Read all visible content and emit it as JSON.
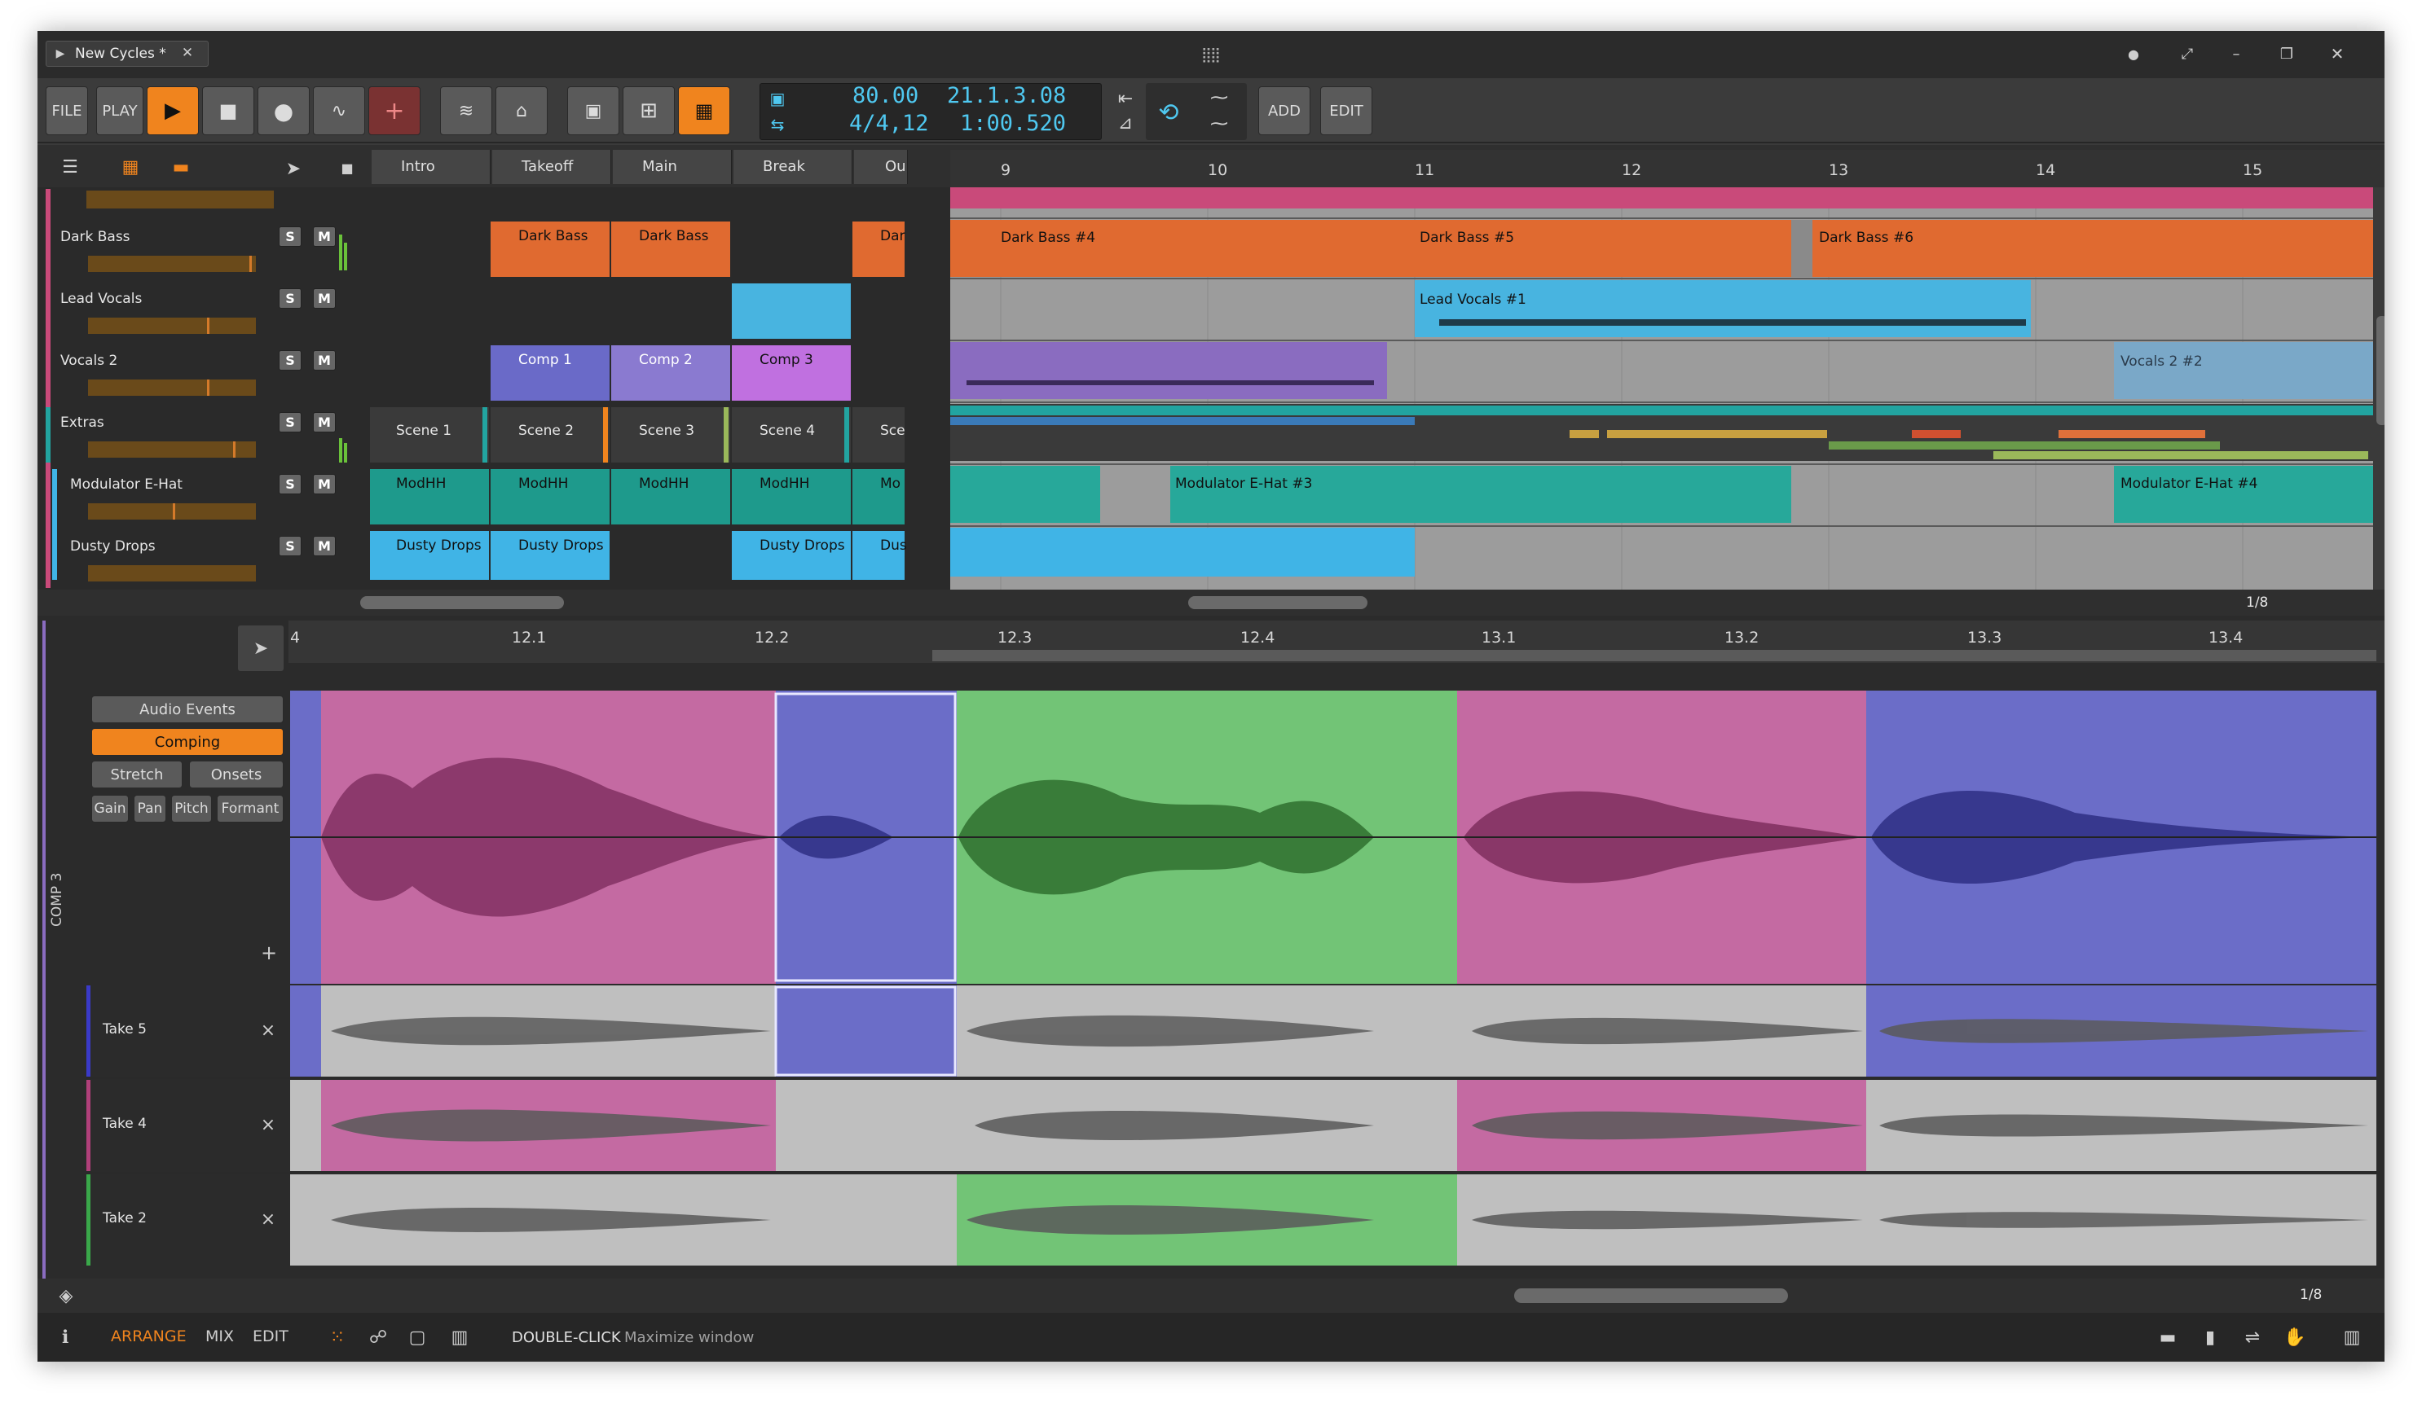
{
  "title_bar": {
    "tab_label": "New Cycles *",
    "close": "✕"
  },
  "transport": {
    "file_label": "FILE",
    "play_label": "PLAY",
    "tempo": "80.00",
    "time_signature": "4/4,12",
    "position_bars": "21.1.3.08",
    "position_time": "1:00.520",
    "add_label": "ADD",
    "edit_label": "EDIT"
  },
  "scenes": [
    "Intro",
    "Takeoff",
    "Main",
    "Break",
    "Ou"
  ],
  "timeline_bars": [
    "9",
    "10",
    "11",
    "12",
    "13",
    "14",
    "15"
  ],
  "tracks": [
    {
      "name": "Dark Bass",
      "clips": [
        "Dark Bass",
        "Dark Bass",
        "",
        "Dar"
      ],
      "arr": [
        "Dark Bass #4",
        "Dark Bass #5",
        "Dark Bass #6"
      ]
    },
    {
      "name": "Lead Vocals",
      "arr": [
        "Lead Vocals #1"
      ]
    },
    {
      "name": "Vocals 2",
      "clips": [
        "Comp 1",
        "Comp 2",
        "Comp 3"
      ],
      "arr": [
        "Vocals 2 #2"
      ]
    },
    {
      "name": "Extras",
      "clips": [
        "Scene 1",
        "Scene 2",
        "Scene 3",
        "Scene 4",
        "Sce"
      ]
    },
    {
      "name": "Modulator E-Hat",
      "clips": [
        "ModHH",
        "ModHH",
        "ModHH",
        "ModHH",
        "Mo"
      ],
      "arr": [
        "Modulator E-Hat #3",
        "Modulator E-Hat #4"
      ]
    },
    {
      "name": "Dusty Drops",
      "clips": [
        "Dusty Drops",
        "Dusty Drops",
        "Dusty Drops",
        "Dus"
      ]
    }
  ],
  "track_buttons": {
    "solo": "S",
    "mute": "M"
  },
  "zoom_top": "1/8",
  "zoom_bottom": "1/8",
  "editor": {
    "ruler": [
      "4",
      "12.1",
      "12.2",
      "12.3",
      "12.4",
      "13.1",
      "13.2",
      "13.3",
      "13.4"
    ],
    "buttons": {
      "audio_events": "Audio Events",
      "comping": "Comping",
      "stretch": "Stretch",
      "onsets": "Onsets",
      "gain": "Gain",
      "pan": "Pan",
      "pitch": "Pitch",
      "formant": "Formant"
    },
    "comp_label": "COMP 3",
    "plus": "+",
    "takes": [
      "Take 5",
      "Take 4",
      "Take 2"
    ],
    "take_close": "×"
  },
  "status_bar": {
    "arrange": "ARRANGE",
    "mix": "MIX",
    "edit": "EDIT",
    "hint_key": "DOUBLE-CLICK",
    "hint_text": "Maximize window"
  },
  "colors": {
    "accent": "#f0841e",
    "comp_pink": "#c46aa2",
    "comp_blue": "#6b6dc8",
    "comp_green": "#72c476",
    "lcd": "#4fc8f0",
    "dark_bass": "#e06a30",
    "lead_vocals": "#48b4e0",
    "vocals2": "#8a6cc0",
    "extras": "#22a4a0",
    "modulator": "#27a89a",
    "dusty": "#40b4e6"
  }
}
